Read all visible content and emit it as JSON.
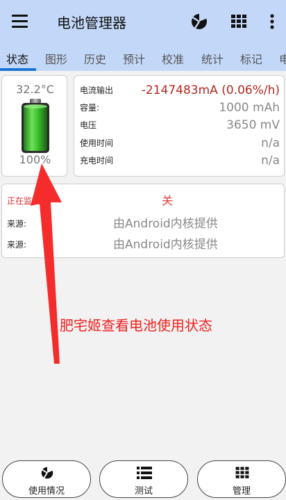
{
  "appbar": {
    "title": "电池管理器",
    "menu_icon": "hamburger-menu-icon",
    "actions": [
      "pie-chart-icon",
      "grid-icon",
      "more-vert-icon"
    ]
  },
  "tabs": [
    "状态",
    "图形",
    "历史",
    "预计",
    "校准",
    "统计",
    "标记",
    "电"
  ],
  "active_tab": "状态",
  "battery": {
    "temperature": "32.2°C",
    "percent": "100%",
    "level": 1.0,
    "fill_color": "#3ec22e"
  },
  "stats": [
    {
      "label": "电流输出",
      "value": "-2147483mA (0.06%/h)",
      "color": "#b3261e"
    },
    {
      "label": "容量:",
      "value": "1000 mAh"
    },
    {
      "label": "电压",
      "value": "3650 mV"
    },
    {
      "label": "使用时间",
      "value": "n/a"
    },
    {
      "label": "充电时间",
      "value": "n/a"
    }
  ],
  "monitor": {
    "label": "正在监控",
    "value": "关",
    "sources": [
      {
        "label": "来源:",
        "value": "由Android内核提供"
      },
      {
        "label": "来源:",
        "value": "由Android内核提供"
      }
    ]
  },
  "annotation": "肥宅姬查看电池使用状态",
  "accent_color": "#f02020",
  "bottom_buttons": [
    {
      "label": "使用情况",
      "icon": "pie-chart-icon"
    },
    {
      "label": "测试",
      "icon": "list-icon"
    },
    {
      "label": "管理",
      "icon": "grid-icon"
    }
  ]
}
